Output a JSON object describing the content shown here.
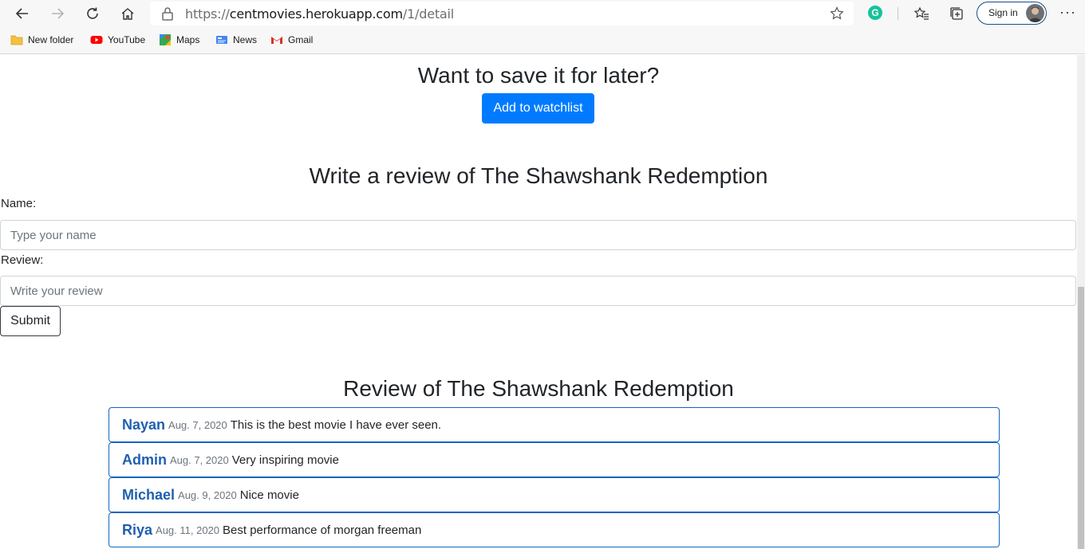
{
  "browser": {
    "url_prefix": "https://",
    "url_host": "centmovies.herokuapp.com",
    "url_path": "/1/detail",
    "signin_label": "Sign in",
    "more_label": "···",
    "bookmarks": [
      {
        "label": "New folder",
        "icon": "folder-icon"
      },
      {
        "label": "YouTube",
        "icon": "youtube-icon"
      },
      {
        "label": "Maps",
        "icon": "maps-icon"
      },
      {
        "label": "News",
        "icon": "news-icon"
      },
      {
        "label": "Gmail",
        "icon": "gmail-icon"
      }
    ]
  },
  "page": {
    "save_heading": "Want to save it for later?",
    "watchlist_button": "Add to watchlist",
    "review_heading": "Write a review of The Shawshank Redemption",
    "name_label": "Name:",
    "name_placeholder": "Type your name",
    "review_label": "Review:",
    "review_placeholder": "Write your review",
    "submit_label": "Submit",
    "list_heading": "Review of The Shawshank Redemption",
    "reviews": [
      {
        "name": "Nayan",
        "date": "Aug. 7, 2020",
        "text": "This is the best movie I have ever seen."
      },
      {
        "name": "Admin",
        "date": "Aug. 7, 2020",
        "text": "Very inspiring movie"
      },
      {
        "name": "Michael",
        "date": "Aug. 9, 2020",
        "text": "Nice movie"
      },
      {
        "name": "Riya",
        "date": "Aug. 11, 2020",
        "text": "Best performance of morgan freeman"
      }
    ]
  },
  "colors": {
    "primary": "#007bff",
    "review_border": "#1565c0",
    "review_name": "#1f5fb0"
  }
}
